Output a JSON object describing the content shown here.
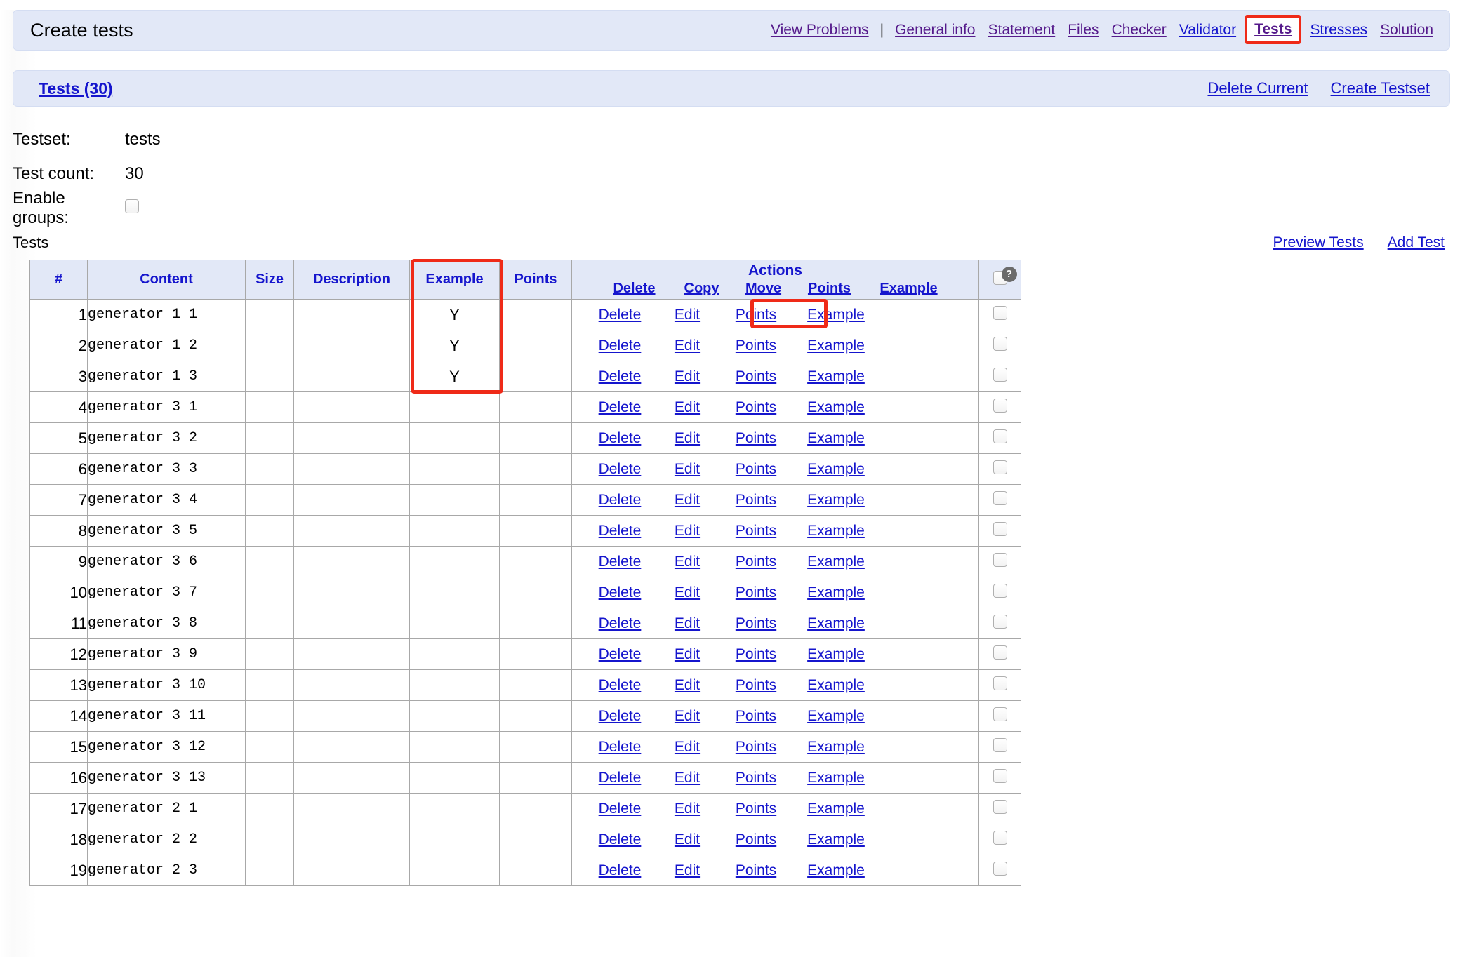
{
  "header": {
    "title": "Create tests",
    "nav": [
      {
        "label": "View Problems",
        "style": "purple"
      },
      {
        "label": "|",
        "style": "separator"
      },
      {
        "label": "General info",
        "style": "purple"
      },
      {
        "label": "Statement",
        "style": "purple"
      },
      {
        "label": "Files",
        "style": "purple"
      },
      {
        "label": "Checker",
        "style": "purple"
      },
      {
        "label": "Validator",
        "style": "blue"
      },
      {
        "label": "Tests",
        "style": "highlighted"
      },
      {
        "label": "Stresses",
        "style": "blue"
      },
      {
        "label": "Solution",
        "style": "purple"
      }
    ]
  },
  "subheader": {
    "tests_link": "Tests (30)",
    "delete_current": "Delete Current",
    "create_testset": "Create Testset"
  },
  "info": {
    "testset_label": "Testset:",
    "testset_value": "tests",
    "test_count_label": "Test count:",
    "test_count_value": "30",
    "enable_groups_label": "Enable groups:",
    "enable_groups_checked": false
  },
  "tests_section": {
    "label": "Tests",
    "preview_tests": "Preview Tests",
    "add_test": "Add Test"
  },
  "table": {
    "columns": {
      "num": "#",
      "content": "Content",
      "size": "Size",
      "description": "Description",
      "example": "Example",
      "points": "Points",
      "actions": "Actions",
      "select_all": "select-all-checkbox"
    },
    "actions_header_links": {
      "delete": "Delete",
      "copy": "Copy",
      "move": "Move",
      "points": "Points",
      "example": "Example"
    },
    "row_action_labels": {
      "delete": "Delete",
      "edit": "Edit",
      "points": "Points",
      "example": "Example"
    },
    "rows": [
      {
        "num": "1",
        "content": "generator 1 1",
        "size": "",
        "description": "",
        "example": "Y",
        "points": ""
      },
      {
        "num": "2",
        "content": "generator 1 2",
        "size": "",
        "description": "",
        "example": "Y",
        "points": ""
      },
      {
        "num": "3",
        "content": "generator 1 3",
        "size": "",
        "description": "",
        "example": "Y",
        "points": ""
      },
      {
        "num": "4",
        "content": "generator 3 1",
        "size": "",
        "description": "",
        "example": "",
        "points": ""
      },
      {
        "num": "5",
        "content": "generator 3 2",
        "size": "",
        "description": "",
        "example": "",
        "points": ""
      },
      {
        "num": "6",
        "content": "generator 3 3",
        "size": "",
        "description": "",
        "example": "",
        "points": ""
      },
      {
        "num": "7",
        "content": "generator 3 4",
        "size": "",
        "description": "",
        "example": "",
        "points": ""
      },
      {
        "num": "8",
        "content": "generator 3 5",
        "size": "",
        "description": "",
        "example": "",
        "points": ""
      },
      {
        "num": "9",
        "content": "generator 3 6",
        "size": "",
        "description": "",
        "example": "",
        "points": ""
      },
      {
        "num": "10",
        "content": "generator 3 7",
        "size": "",
        "description": "",
        "example": "",
        "points": ""
      },
      {
        "num": "11",
        "content": "generator 3 8",
        "size": "",
        "description": "",
        "example": "",
        "points": ""
      },
      {
        "num": "12",
        "content": "generator 3 9",
        "size": "",
        "description": "",
        "example": "",
        "points": ""
      },
      {
        "num": "13",
        "content": "generator 3 10",
        "size": "",
        "description": "",
        "example": "",
        "points": ""
      },
      {
        "num": "14",
        "content": "generator 3 11",
        "size": "",
        "description": "",
        "example": "",
        "points": ""
      },
      {
        "num": "15",
        "content": "generator 3 12",
        "size": "",
        "description": "",
        "example": "",
        "points": ""
      },
      {
        "num": "16",
        "content": "generator 3 13",
        "size": "",
        "description": "",
        "example": "",
        "points": ""
      },
      {
        "num": "17",
        "content": "generator 2 1",
        "size": "",
        "description": "",
        "example": "",
        "points": ""
      },
      {
        "num": "18",
        "content": "generator 2 2",
        "size": "",
        "description": "",
        "example": "",
        "points": ""
      },
      {
        "num": "19",
        "content": "generator 2 3",
        "size": "",
        "description": "",
        "example": "",
        "points": ""
      }
    ]
  },
  "annotations": {
    "nav_tests_box": "#ef2a18",
    "example_column_box": "#ef2a18",
    "example_link_box": "#ef2a18"
  },
  "colors": {
    "link_blue": "#1515cd",
    "link_purple": "#551a8b",
    "panel_blue": "#e2e8f7",
    "annotation_red": "#ef2a18"
  }
}
